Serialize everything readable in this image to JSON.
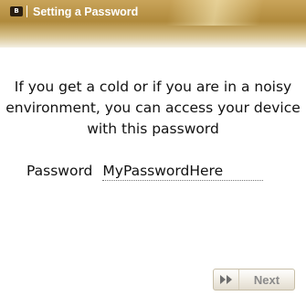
{
  "header": {
    "logo_text": "B",
    "title": "Setting a Password"
  },
  "main": {
    "message": "If you get a cold or if you are in a noisy environment, you can access your device with this password",
    "password_label": "Password",
    "password_value": "MyPasswordHere"
  },
  "footer": {
    "next_label": "Next",
    "next_icon": "fast-forward-icon"
  },
  "colors": {
    "header_gold": "#b08a3c",
    "header_text": "#ffffff",
    "body_text": "#111111",
    "button_text": "#8a8a8a"
  }
}
